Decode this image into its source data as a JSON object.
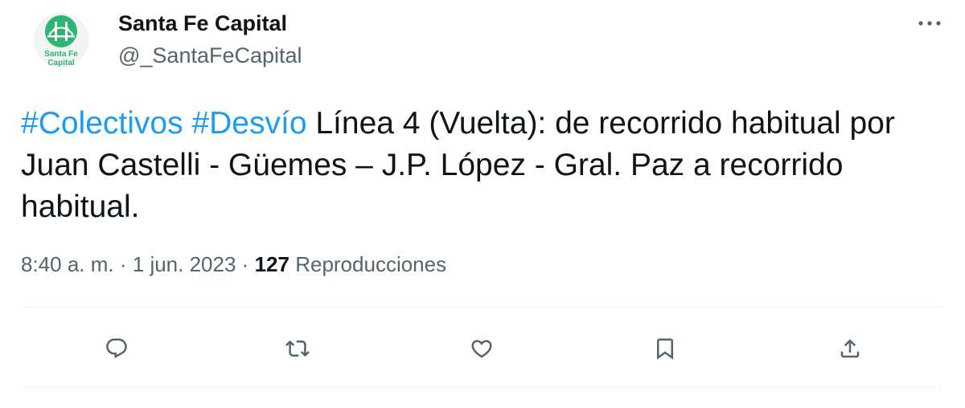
{
  "tweet": {
    "author": {
      "display_name": "Santa Fe Capital",
      "handle": "@_SantaFeCapital",
      "avatar_text_line1": "Santa Fe",
      "avatar_text_line2": "Capital",
      "avatar_color": "#2bb673"
    },
    "text": {
      "hashtag1": "#Colectivos",
      "hashtag2": "#Desvío",
      "body": "Línea 4 (Vuelta): de recorrido habitual por Juan Castelli - Güemes – J.P. López - Gral. Paz a recorrido habitual."
    },
    "meta": {
      "time": "8:40 a. m.",
      "separator1": "·",
      "date": "1 jun. 2023",
      "separator2": "·",
      "views_count": "127",
      "views_label": "Reproducciones"
    },
    "actions": [
      {
        "name": "reply",
        "icon": "reply-icon"
      },
      {
        "name": "retweet",
        "icon": "retweet-icon"
      },
      {
        "name": "like",
        "icon": "heart-icon"
      },
      {
        "name": "bookmark",
        "icon": "bookmark-icon"
      },
      {
        "name": "share",
        "icon": "share-icon"
      }
    ],
    "colors": {
      "link": "#1d9bf0",
      "secondary_text": "#536471",
      "primary_text": "#0f1419",
      "icon": "#536471",
      "divider": "#eff3f4"
    }
  }
}
